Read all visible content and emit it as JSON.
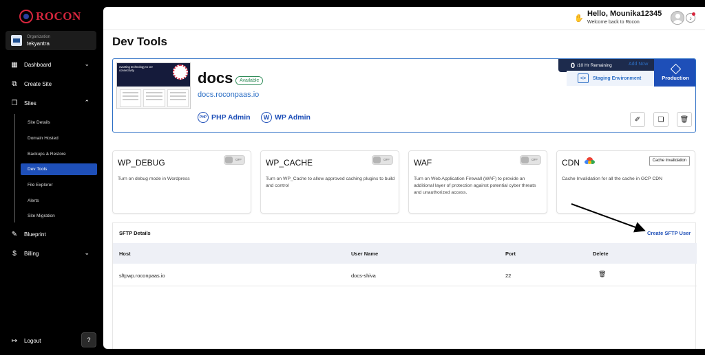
{
  "sidebar": {
    "logo": "ROCON",
    "org_label": "Organization",
    "org_name": "tekyantra",
    "items": [
      {
        "label": "Dashboard",
        "icon": "grid-icon"
      },
      {
        "label": "Create Site",
        "icon": "create-site-icon"
      },
      {
        "label": "Sites",
        "icon": "sites-icon"
      },
      {
        "label": "Blueprint",
        "icon": "blueprint-icon"
      },
      {
        "label": "Billing",
        "icon": "dollar-icon"
      }
    ],
    "sub_items": [
      "Site Details",
      "Domain Hosted",
      "Backups & Restore",
      "Dev Tools",
      "File Explorer",
      "Alerts",
      "Site Migration"
    ],
    "active_sub": "Dev Tools",
    "logout": "Logout"
  },
  "header": {
    "greeting": "Hello, Mounika12345",
    "welcome": "Welcome back to Rocon"
  },
  "page": {
    "title": "Dev Tools"
  },
  "site": {
    "thumb_text": "ovanting technology to ver connectivity",
    "name": "docs",
    "status": "Available",
    "url": "docs.roconpaas.io",
    "php_admin": "PHP Admin",
    "php_icon_text": "PHP",
    "wp_admin": "WP Admin",
    "quota_number": "0",
    "quota_text": "/10 Hr Remaining",
    "add_now": "Add Now",
    "staging": "Staging Environment",
    "production": "Production"
  },
  "features": [
    {
      "title": "WP_DEBUG",
      "toggle": "OFF",
      "desc": "Turn on debug mode in Wordpress"
    },
    {
      "title": "WP_CACHE",
      "toggle": "OFF",
      "desc": "Turn on WP_Cache to allow approved caching plugins to build and control"
    },
    {
      "title": "WAF",
      "toggle": "OFF",
      "desc": "Turn on Web Application Firewall (WAF) to provide an additional layer of protection against potential cyber threats and unauthorized access."
    },
    {
      "title": "CDN",
      "button": "Cache Invalidation",
      "desc": "Cache Invalidation for all the cache in GCP CDN"
    }
  ],
  "sftp": {
    "title": "SFTP Details",
    "create": "Create SFTP User",
    "headers": [
      "Host",
      "User Name",
      "Port",
      "Delete"
    ],
    "rows": [
      {
        "host": "sftpwp.roconpaas.io",
        "user": "docs-shiva",
        "port": "22"
      }
    ]
  },
  "colors": {
    "accent": "#1e4fb8",
    "brand": "#d7263d",
    "status_green": "#2e8b57"
  }
}
